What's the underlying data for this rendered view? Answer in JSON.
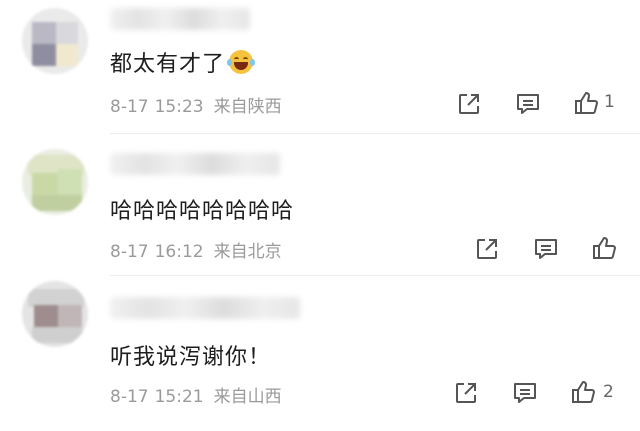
{
  "comments": [
    {
      "text": "都太有才了",
      "date": "8-17",
      "time": "15:23",
      "location": "来自陕西",
      "likes": "1",
      "emoji": "grinning-tears-emoji"
    },
    {
      "text": "哈哈哈哈哈哈哈哈",
      "date": "8-17",
      "time": "16:12",
      "location": "来自北京",
      "likes": ""
    },
    {
      "text": "听我说泻谢你！",
      "date": "8-17",
      "time": "15:21",
      "location": "来自山西",
      "likes": "2"
    }
  ],
  "icons": {
    "share": "share-icon",
    "comment": "comment-icon",
    "like": "thumbs-up-icon"
  },
  "colors": {
    "text": "#1e1e1e",
    "meta": "#9a9a9a",
    "icon": "#555555"
  }
}
